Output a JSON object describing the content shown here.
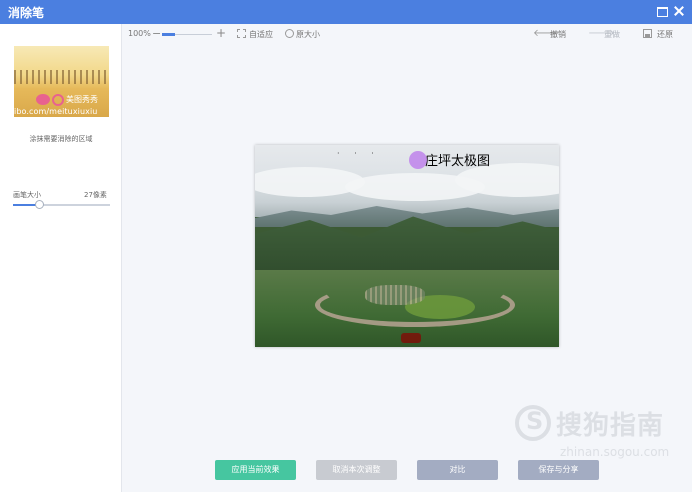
{
  "window": {
    "title": "消除笔"
  },
  "left_panel": {
    "thumbnail": {
      "watermark_name": "美图秀秀",
      "watermark_url": "ibo.com/meituxiuxiu"
    },
    "hint": "涂抹需要消除的区域",
    "brush": {
      "label": "画笔大小",
      "value": "27像素",
      "level_fraction": 0.27
    }
  },
  "toolbar": {
    "zoom": "100%",
    "zoom_level_fraction": 0.25,
    "minus": "−",
    "plus": "+",
    "fit": "自适应",
    "original": "原大小",
    "undo": "撤销",
    "redo": "重做",
    "restore": "还原",
    "undo_arrow": "🡐",
    "redo_arrow": "🡒"
  },
  "canvas": {
    "caption": "庄坪太极图",
    "dots": "· · ·"
  },
  "buttons": {
    "apply": "应用当前效果",
    "cancel": "取消本次调整",
    "compare": "对比",
    "save": "保存与分享"
  },
  "watermark": {
    "text": "搜狗指南",
    "url": "zhinan.sogou.com"
  },
  "colors": {
    "titlebar": "#4b7fe0",
    "apply": "#46c6a0",
    "accent": "#4b7fe0"
  }
}
